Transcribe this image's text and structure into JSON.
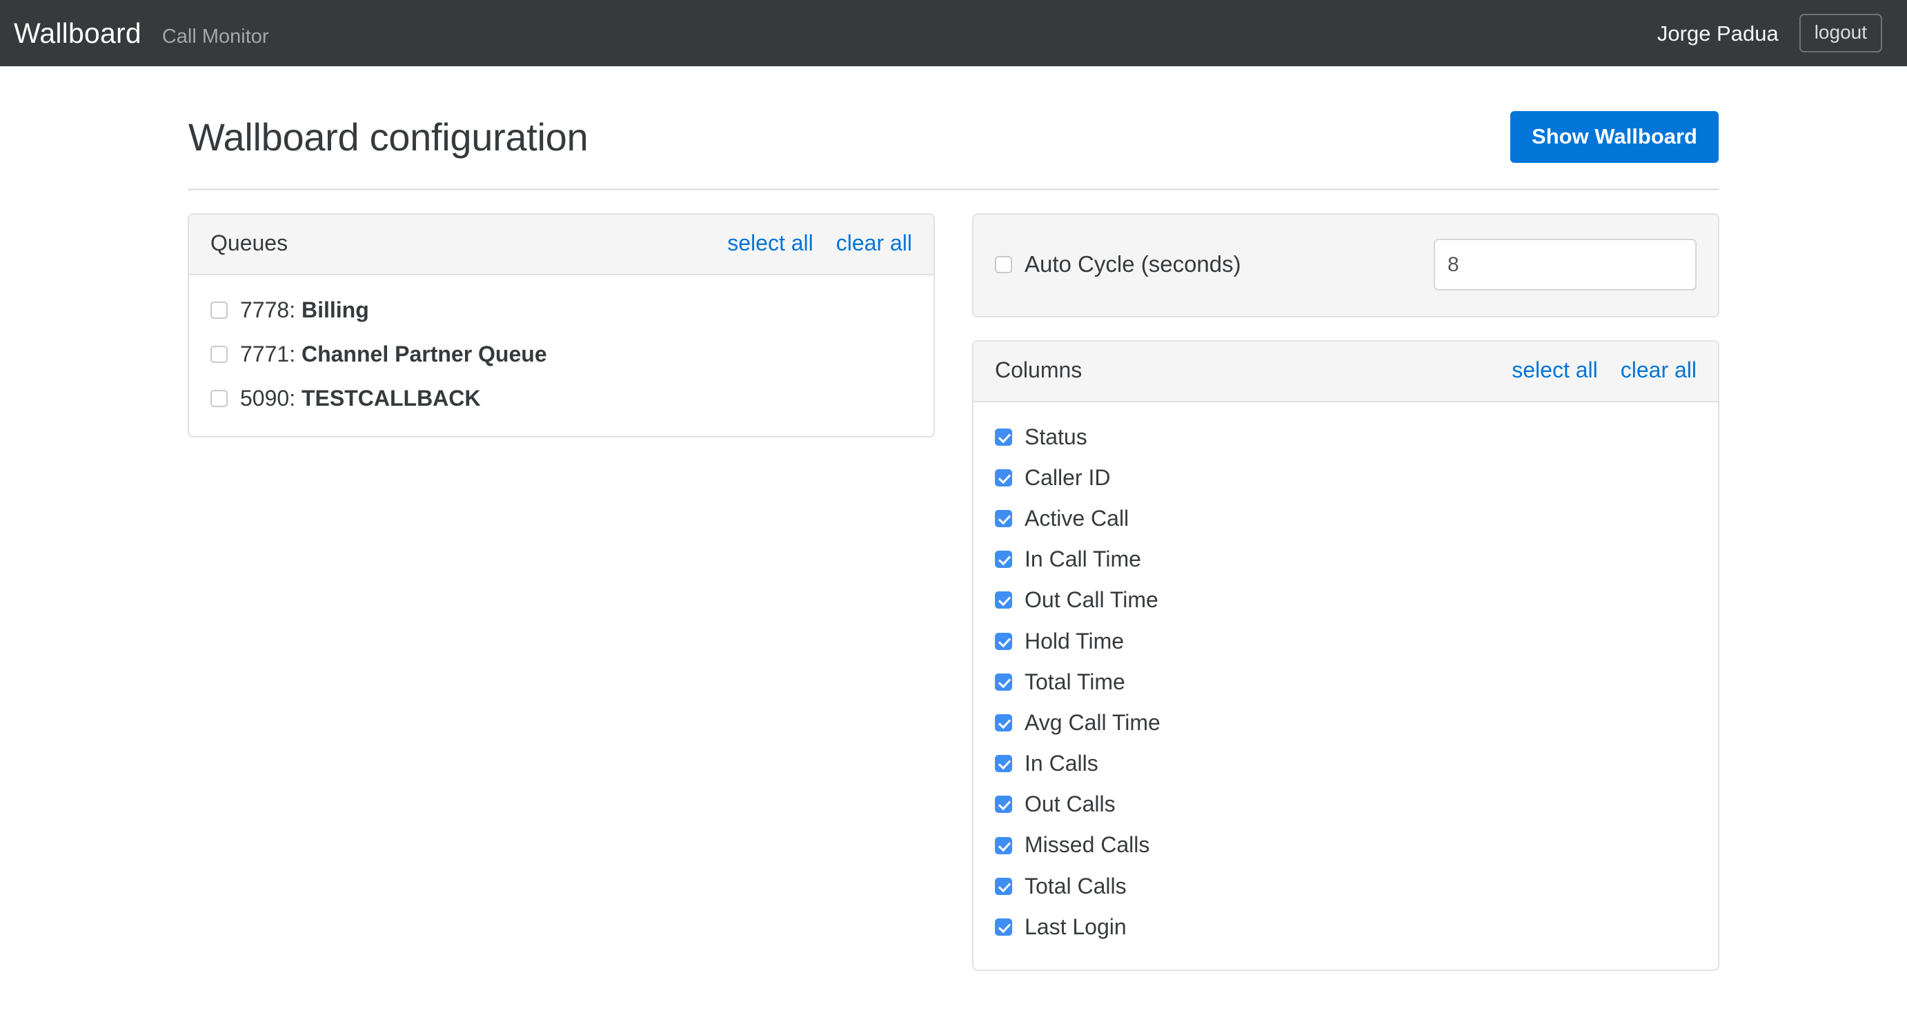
{
  "navbar": {
    "brand": "Wallboard",
    "nav_link": "Call Monitor",
    "user_name": "Jorge Padua",
    "logout_label": "logout"
  },
  "page": {
    "title": "Wallboard configuration",
    "show_wallboard_label": "Show Wallboard"
  },
  "queues_panel": {
    "title": "Queues",
    "select_all_label": "select all",
    "clear_all_label": "clear all",
    "items": [
      {
        "id": "7778: ",
        "name": "Billing",
        "checked": false
      },
      {
        "id": "7771: ",
        "name": "Channel Partner Queue",
        "checked": false
      },
      {
        "id": "5090: ",
        "name": "TESTCALLBACK",
        "checked": false
      }
    ]
  },
  "auto_cycle": {
    "label": "Auto Cycle (seconds)",
    "checked": false,
    "value": "8",
    "placeholder": ""
  },
  "columns_panel": {
    "title": "Columns",
    "select_all_label": "select all",
    "clear_all_label": "clear all",
    "items": [
      {
        "label": "Status",
        "checked": true
      },
      {
        "label": "Caller ID",
        "checked": true
      },
      {
        "label": "Active Call",
        "checked": true
      },
      {
        "label": "In Call Time",
        "checked": true
      },
      {
        "label": "Out Call Time",
        "checked": true
      },
      {
        "label": "Hold Time",
        "checked": true
      },
      {
        "label": "Total Time",
        "checked": true
      },
      {
        "label": "Avg Call Time",
        "checked": true
      },
      {
        "label": "In Calls",
        "checked": true
      },
      {
        "label": "Out Calls",
        "checked": true
      },
      {
        "label": "Missed Calls",
        "checked": true
      },
      {
        "label": "Total Calls",
        "checked": true
      },
      {
        "label": "Last Login",
        "checked": true
      }
    ]
  },
  "colors": {
    "navbar_bg": "#373a3c",
    "primary": "#0275d8",
    "link": "#0275d8",
    "checkbox_checked": "#3e8ef4",
    "card_header_bg": "#f5f5f5",
    "border": "#e1e1e1"
  }
}
